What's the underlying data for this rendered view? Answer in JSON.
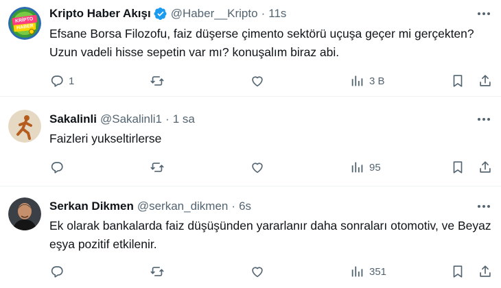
{
  "tweets": [
    {
      "name": "Kripto Haber Akışı",
      "handle": "@Haber__Kripto",
      "time": "11s",
      "verified": true,
      "avatar_icon": "kripto-haber-logo",
      "avatar_text": "KRİPTO HABER",
      "text": "Efsane Borsa Filozofu, faiz düşerse çimento sektörü uçuşa geçer mi gerçekten? Uzun vadeli hisse sepetin var mı? konuşalım biraz abi.",
      "replies": "1",
      "retweets": "",
      "likes": "",
      "views": "3 B"
    },
    {
      "name": "Sakalinli",
      "handle": "@Sakalinli1",
      "time": "1 sa",
      "verified": false,
      "avatar_icon": "runner-statue-avatar",
      "text": "Faizleri yukseltirlerse",
      "replies": "",
      "retweets": "",
      "likes": "",
      "views": "95"
    },
    {
      "name": "Serkan Dikmen",
      "handle": "@serkan_dikmen",
      "time": "6s",
      "verified": false,
      "avatar_icon": "person-photo-avatar",
      "text": "Ek olarak bankalarda  faiz düşüşünden yararlanır daha sonraları otomotiv, ve Beyaz eşya pozitif etkilenir.",
      "replies": "",
      "retweets": "",
      "likes": "",
      "views": "351"
    }
  ],
  "colors": {
    "text": "#0f1419",
    "secondary": "#536471",
    "verified": "#1d9bf0",
    "border": "#eff3f4"
  }
}
